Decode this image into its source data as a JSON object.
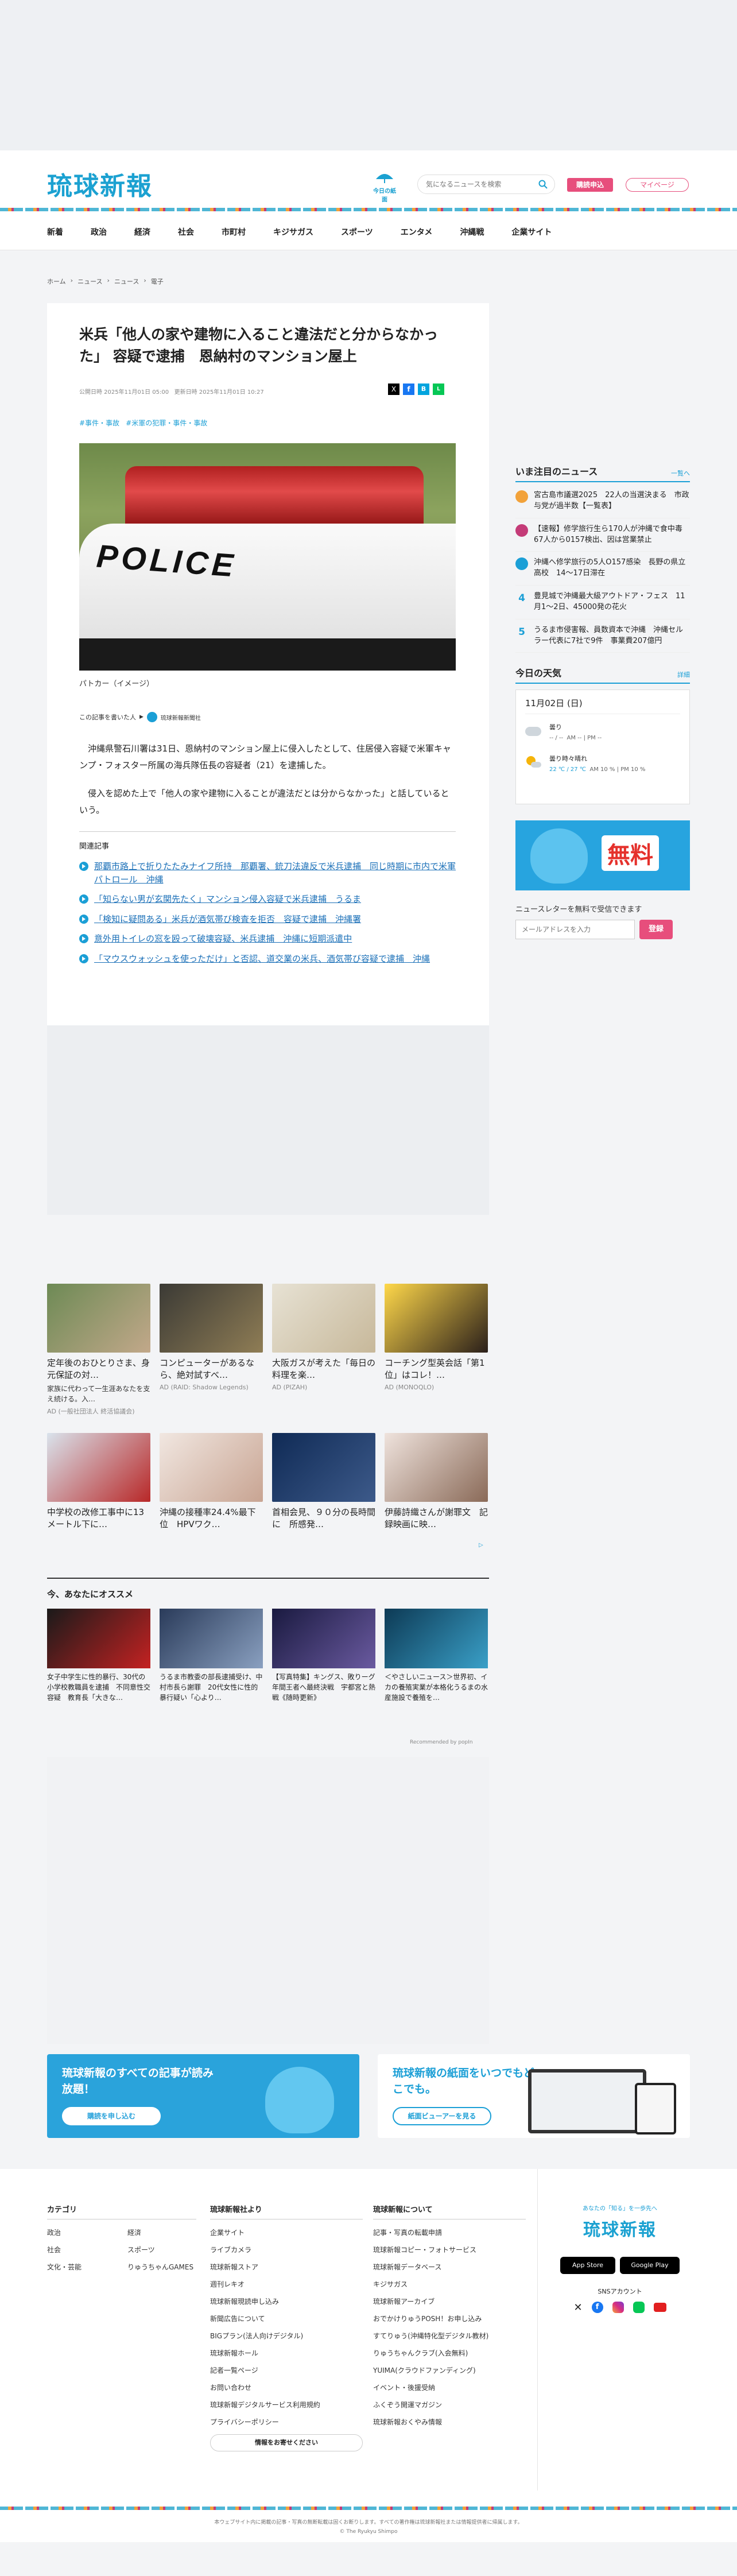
{
  "header": {
    "logo": "琉球新報",
    "weather_label": "今日の紙面",
    "search_placeholder": "気になるニュースを検索",
    "subscribe_label": "購読申込",
    "mypage_label": "マイページ"
  },
  "nav": [
    "新着",
    "政治",
    "経済",
    "社会",
    "市町村",
    "キジサガス",
    "スポーツ",
    "エンタメ",
    "沖縄戦",
    "企業サイト"
  ],
  "breadcrumb": [
    "ホーム",
    "ニュース",
    "ニュース",
    "電子"
  ],
  "article": {
    "title": "米兵「他人の家や建物に入ること違法だと分からなかった」 容疑で逮捕　恩納村のマンション屋上",
    "published": "公開日時 2025年11月01日 05:00",
    "updated": "更新日時 2025年11月01日 10:27",
    "tags": [
      "#事件・事故",
      "#米軍の犯罪・事件・事故"
    ],
    "photo_text": "POLICE",
    "caption": "パトカー（イメージ）",
    "author_label": "この記事を書いた人",
    "author": "琉球新報新聞社",
    "body": [
      "沖縄県警石川署は31日、恩納村のマンション屋上に侵入したとして、住居侵入容疑で米軍キャンプ・フォスター所属の海兵隊伍長の容疑者（21）を逮捕した。",
      "侵入を認めた上で「他人の家や建物に入ることが違法だとは分からなかった」と話しているという。"
    ],
    "related_title": "関連記事",
    "related": [
      "那覇市路上で折りたたみナイフ所持　那覇署、銃刀法違反で米兵逮捕　同じ時期に市内で米軍パトロール　沖縄",
      "「知らない男が玄関先たく」マンション侵入容疑で米兵逮捕　うるま",
      "「検知に疑問ある」米兵が酒気帯び検査を拒否　容疑で逮捕　沖縄署",
      "意外用トイレの窓を殴って破壊容疑、米兵逮捕　沖縄に短期派遣中",
      "「マウスウォッシュを使っただけ」と否認、道交業の米兵、酒気帯び容疑で逮捕　沖縄"
    ]
  },
  "sidebar": {
    "ranking_title": "いま注目のニュース",
    "ranking_more": "一覧へ",
    "ranking": [
      {
        "rank": "1",
        "text": "宮古島市議選2025　22人の当選決まる　市政与党が過半数【一覧表】"
      },
      {
        "rank": "2",
        "text": "【速報】修学旅行生ら170人が沖縄で食中毒　67人から0157検出、因は営業禁止"
      },
      {
        "rank": "3",
        "text": "沖縄へ修学旅行の5人O157感染　長野の県立高校　14～17日滞在"
      },
      {
        "rank": "4",
        "text": "豊見城で沖縄最大級アウトドア・フェス　11月1～2日、45000発の花火"
      },
      {
        "rank": "5",
        "text": "うるま市侵害報、員数資本で沖縄　沖縄セルラー代表に7社で9件　事業費207億円"
      }
    ],
    "weather_title": "今日の天気",
    "weather_more": "詳細",
    "weather_date": "11月02日 (日)",
    "weather_rows": [
      {
        "label": "曇り",
        "temp": "-- / --",
        "detail": "AM -- | PM --"
      },
      {
        "label": "曇り時々晴れ",
        "temp": "22 ℃ / 27 ℃",
        "detail": "AM 10 % | PM 10 %"
      }
    ],
    "ad_text": "無料",
    "newsletter_title": "ニュースレターを無料で受信できます",
    "newsletter_placeholder": "メールアドレスを入力",
    "newsletter_button": "登録"
  },
  "ad_cards": [
    {
      "title": "定年後のおひとりさま、身元保証の対…",
      "sub": "家族に代わって一生涯あなたを支え続ける。入…",
      "src": "AD (一般社団法人 終活協議会)"
    },
    {
      "title": "コンピューターがあるなら、絶対試すべ…",
      "sub": "",
      "src": "AD (RAID: Shadow Legends)"
    },
    {
      "title": "大阪ガスが考えた「毎日の料理を楽…",
      "sub": "",
      "src": "AD (PIZAH)"
    },
    {
      "title": "コーチング型英会話「第1位」はコレ！…",
      "sub": "",
      "src": "AD (MONOQLO)"
    },
    {
      "title": "中学校の改修工事中に13メートル下に…",
      "sub": "",
      "src": ""
    },
    {
      "title": "沖縄の接種率24.4%最下位　HPVワク…",
      "sub": "",
      "src": ""
    },
    {
      "title": "首相会見、９０分の長時間に　所感発…",
      "sub": "",
      "src": ""
    },
    {
      "title": "伊藤詩織さんが謝罪文　記録映画に映…",
      "sub": "",
      "src": ""
    }
  ],
  "recommend": {
    "title": "今、あなたにオススメ",
    "items": [
      "女子中学生に性的暴行、30代の小学校教職員を逮捕　不同意性交容疑　教育長「大きな…",
      "うるま市教委の部長逮捕受け、中村市長ら謝罪　20代女性に性的暴行疑い「心より…",
      "【写真特集】キングス、敗りーグ年間王者へ最終決戦　宇都宮と熱戦《随時更新》",
      "＜やさしいニュース＞世界初、イカの養殖実業が本格化うるまの水産施設で養殖を…"
    ],
    "credit": "Recommended by popIn"
  },
  "banners": {
    "left_title": "琉球新報のすべての記事が読み放題！",
    "left_btn": "購読を申し込む",
    "right_title": "琉球新報の紙面をいつでもどこでも。",
    "right_btn": "紙面ビューアーを見る"
  },
  "footer": {
    "col1_title": "カテゴリ",
    "col1": [
      "政治",
      "経済",
      "社会",
      "スポーツ",
      "文化・芸能",
      "りゅうちゃんGAMES"
    ],
    "col2_title": "琉球新報社より",
    "col2": [
      "企業サイト",
      "ライブカメラ",
      "琉球新報ストア",
      "週刊レキオ",
      "琉球新報現読申し込み",
      "新聞広告について",
      "BIGプラン(法人向けデジタル)",
      "琉球新報ホール",
      "記者一覧ページ",
      "お問い合わせ",
      "琉球新報デジタルサービス利用規約",
      "プライバシーポリシー"
    ],
    "col2_btn": "情報をお寄せください",
    "col3_title": "琉球新報について",
    "col3": [
      "記事・写真の転載申請",
      "琉球新報コピー・フォトサービス",
      "琉球新報データベース",
      "キジサガス",
      "琉球新報アーカイブ",
      "おでかけりゅうPOSH！お申し込み",
      "すてりゅう(沖縄特化型デジタル教材)",
      "りゅうちゃんクラブ(入会無料)",
      "YUIMA(クラウドファンディング)",
      "イベント・後援受納",
      "ふくぞう開運マガジン",
      "琉球新報おくやみ情報"
    ],
    "tagline": "あなたの「知る」を一歩先へ",
    "logo": "琉球新報",
    "appstore": "App Store",
    "googleplay": "Google Play",
    "sns_title": "SNSアカウント",
    "copyright1": "本ウェブサイト内に掲載の記事・写真の無断転載は固くお断りします。すべての著作権は琉球新報社または情報提供者に帰属します。",
    "copyright2": "© The Ryukyu Shimpo"
  }
}
